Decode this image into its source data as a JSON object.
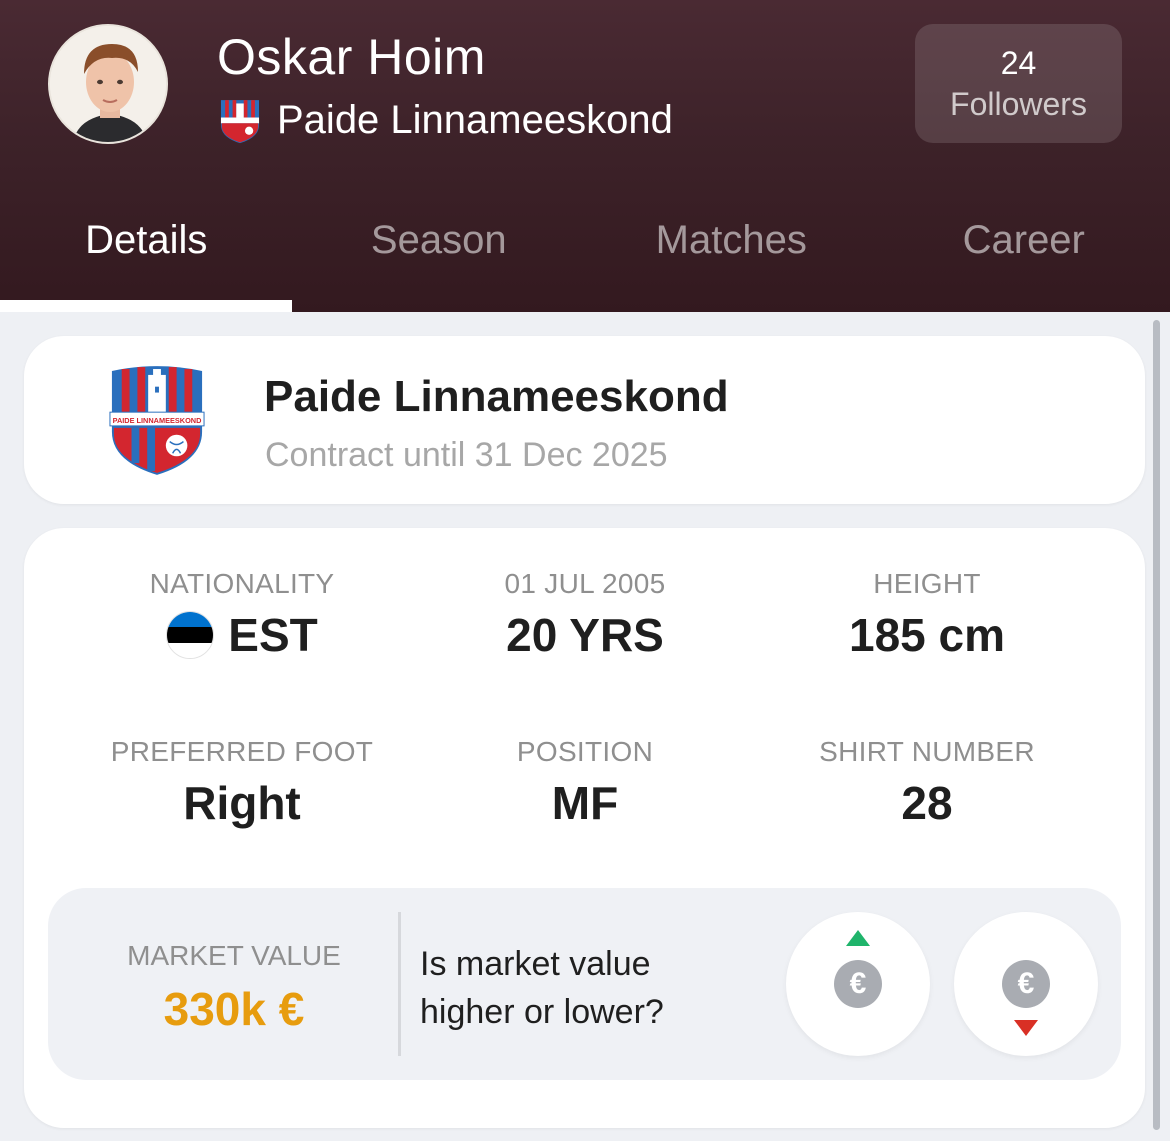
{
  "header": {
    "player_name": "Oskar Hoim",
    "club_name": "Paide Linnameeskond",
    "followers_count": "24",
    "followers_label": "Followers"
  },
  "tabs": [
    {
      "label": "Details",
      "active": true
    },
    {
      "label": "Season",
      "active": false
    },
    {
      "label": "Matches",
      "active": false
    },
    {
      "label": "Career",
      "active": false
    }
  ],
  "contract": {
    "club_name": "Paide Linnameeskond",
    "crest_text": "PAIDE LINNAMEESKOND",
    "until": "Contract until 31 Dec 2025"
  },
  "details": {
    "nationality": {
      "label": "NATIONALITY",
      "value": "EST",
      "flag_colors": [
        "#0072ce",
        "#000000",
        "#ffffff"
      ]
    },
    "birth": {
      "label": "01 JUL 2005",
      "value": "20 YRS"
    },
    "height": {
      "label": "HEIGHT",
      "value": "185 cm"
    },
    "foot": {
      "label": "PREFERRED FOOT",
      "value": "Right"
    },
    "position": {
      "label": "POSITION",
      "value": "MF"
    },
    "shirt": {
      "label": "SHIRT NUMBER",
      "value": "28"
    }
  },
  "market": {
    "label": "MARKET VALUE",
    "value": "330k €",
    "question": "Is market value higher or lower?",
    "coin_symbol": "€"
  },
  "colors": {
    "header_bg": "#3d2229",
    "market_value": "#e79c0e",
    "up_arrow": "#1fb46b",
    "down_arrow": "#d93025"
  }
}
